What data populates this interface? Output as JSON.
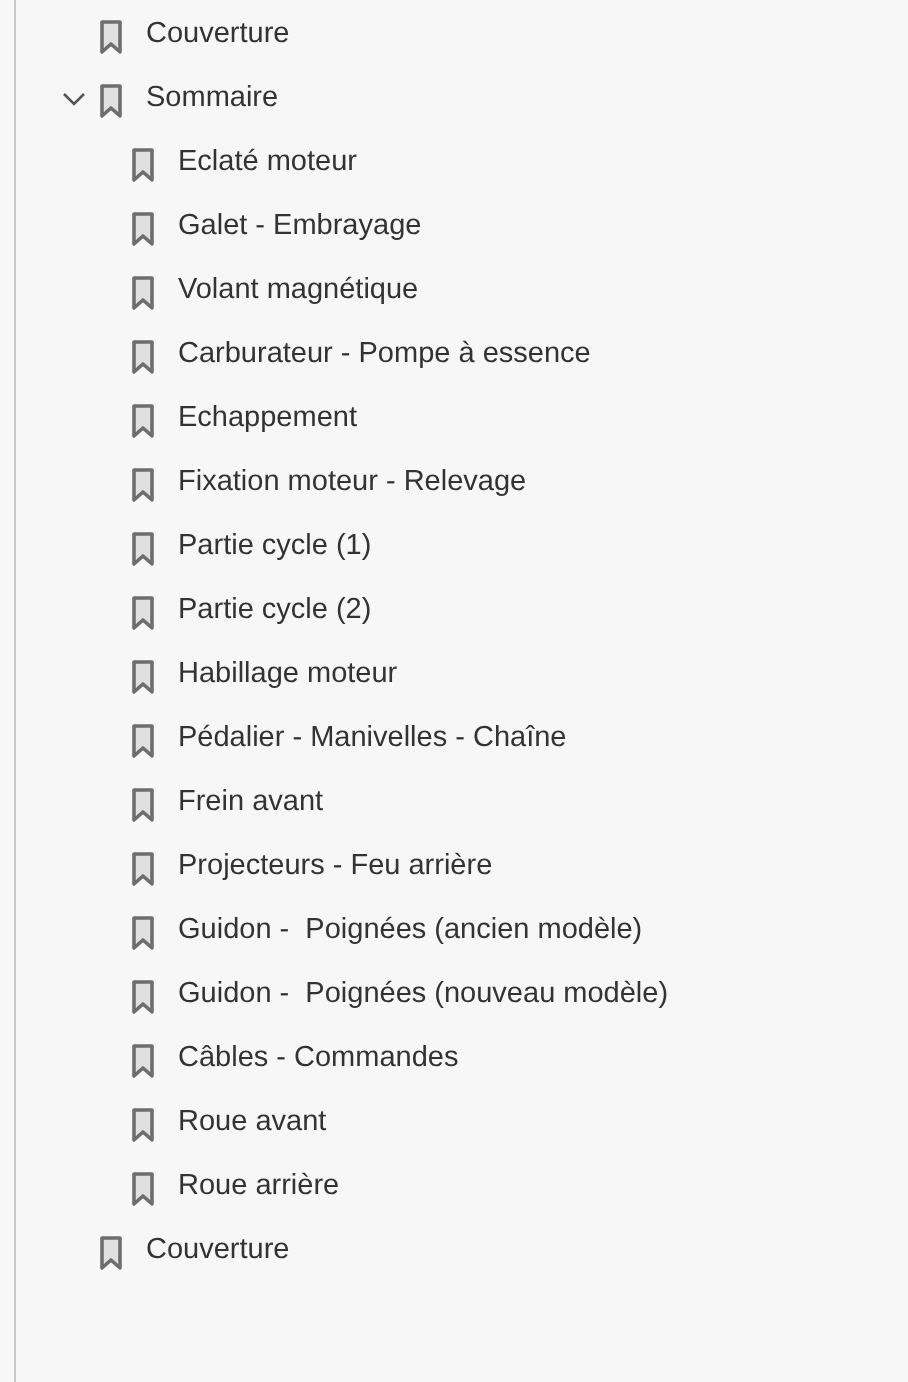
{
  "bookmarks": [
    {
      "label": "Couverture"
    },
    {
      "label": "Sommaire",
      "expanded": true,
      "children": [
        {
          "label": "Eclaté moteur"
        },
        {
          "label": "Galet - Embrayage"
        },
        {
          "label": "Volant magnétique"
        },
        {
          "label": "Carburateur - Pompe à essence"
        },
        {
          "label": "Echappement"
        },
        {
          "label": "Fixation moteur - Relevage"
        },
        {
          "label": "Partie cycle (1)"
        },
        {
          "label": "Partie cycle (2)"
        },
        {
          "label": "Habillage moteur"
        },
        {
          "label": "Pédalier - Manivelles - Chaîne"
        },
        {
          "label": "Frein avant"
        },
        {
          "label": "Projecteurs - Feu arrière"
        },
        {
          "label": "Guidon -  Poignées (ancien modèle)"
        },
        {
          "label": "Guidon -  Poignées (nouveau modèle)"
        },
        {
          "label": "Câbles - Commandes"
        },
        {
          "label": "Roue avant"
        },
        {
          "label": "Roue arrière"
        }
      ]
    },
    {
      "label": "Couverture"
    }
  ]
}
